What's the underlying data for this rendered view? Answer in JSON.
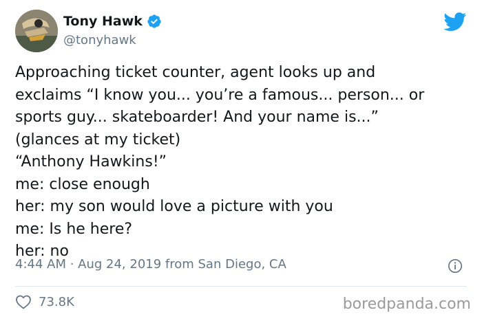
{
  "tweet": {
    "author": {
      "display_name": "Tony Hawk",
      "handle": "@tonyhawk",
      "verified": true
    },
    "text_lines": [
      "Approaching ticket counter, agent looks up and",
      "exclaims “I know you... you’re a famous... person... or",
      "sports guy... skateboarder! And your name is...”",
      "(glances at my ticket)",
      "“Anthony Hawkins!”",
      "me: close enough",
      "her: my son would love a picture with you",
      "me: Is he here?",
      "her: no"
    ],
    "timestamp": "4:44 AM · Aug 24, 2019 from San Diego, CA",
    "likes": "73.8K"
  },
  "watermark": "boredpanda.com",
  "icons": {
    "verified": "verified-badge-icon",
    "platform": "twitter-bird-icon",
    "info": "info-icon",
    "like": "heart-icon"
  },
  "colors": {
    "accent": "#1da1f2",
    "secondary_text": "#657786",
    "primary_text": "#14171a"
  }
}
